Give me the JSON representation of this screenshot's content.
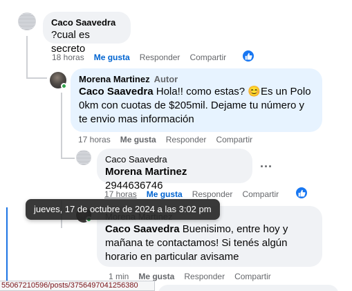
{
  "comments": [
    {
      "author": "Caco Saavedra",
      "badge": "",
      "text": "?cual es secreto",
      "time": "18 horas",
      "like_label": "Me gusta",
      "reply_label": "Responder",
      "share_label": "Compartir",
      "liked": true
    },
    {
      "author": "Morena Martinez",
      "badge": "Autor",
      "mention": "Caco Saavedra",
      "text": " Hola!! como estas? 😊Es un Polo 0km con cuotas de $205mil. Dejame tu número y te envio mas información",
      "time": "17 horas",
      "like_label": "Me gusta",
      "reply_label": "Responder",
      "share_label": "Compartir"
    },
    {
      "author": "Caco Saavedra",
      "mention": "Morena Martinez",
      "text": " 2944636746",
      "time": "17 horas",
      "like_label": "Me gusta",
      "reply_label": "Responder",
      "share_label": "Compartir",
      "liked": true,
      "more_label": "···"
    },
    {
      "author": "Morena Martinez",
      "mention": "Caco Saavedra",
      "text": " Buenisimo, entre hoy y mañana te contactamos! Si tenés algún horario en particular avisame",
      "time": "1 min",
      "like_label": "Me gusta",
      "reply_label": "Responder",
      "share_label": "Compartir"
    }
  ],
  "tooltip": "jueves, 17 de octubre de 2024 a las 3:02 pm",
  "status_url": "55067210596/posts/3756497041256380",
  "colors": {
    "accent": "#1877f2",
    "bubble": "#f0f2f5",
    "bubble_highlight": "#e7f3ff",
    "online": "#31a24c"
  },
  "icons": {
    "like": "thumbs-up-icon",
    "avatar_default": "default-avatar",
    "more": "more-dots-icon"
  }
}
